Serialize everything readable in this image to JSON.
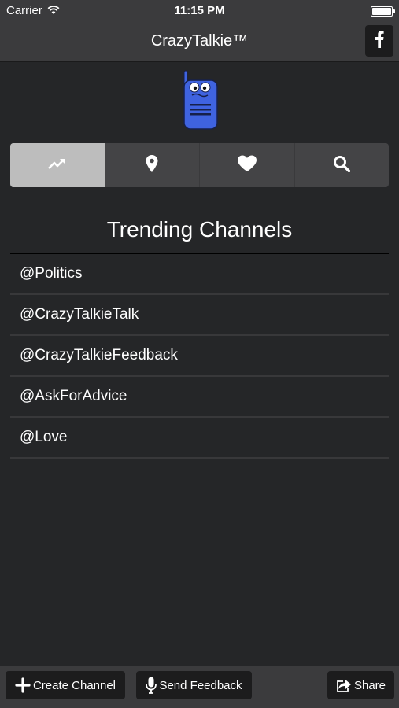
{
  "status_bar": {
    "carrier": "Carrier",
    "time": "11:15 PM"
  },
  "nav": {
    "title": "CrazyTalkie™",
    "facebook_icon": "facebook-icon"
  },
  "tabs": [
    {
      "icon": "trending-icon",
      "active": true
    },
    {
      "icon": "location-pin-icon",
      "active": false
    },
    {
      "icon": "heart-icon",
      "active": false
    },
    {
      "icon": "search-icon",
      "active": false
    }
  ],
  "section": {
    "title": "Trending Channels"
  },
  "channels": [
    "@Politics",
    "@CrazyTalkieTalk",
    "@CrazyTalkieFeedback",
    "@AskForAdvice",
    "@Love"
  ],
  "bottom_bar": {
    "create_channel": "Create Channel",
    "send_feedback": "Send Feedback",
    "share": "Share"
  },
  "colors": {
    "background": "#252628",
    "bar": "#3b3b3d",
    "button": "#1c1c1d",
    "active_tab": "#bdbdbd",
    "logo_blue": "#3f63e0"
  }
}
